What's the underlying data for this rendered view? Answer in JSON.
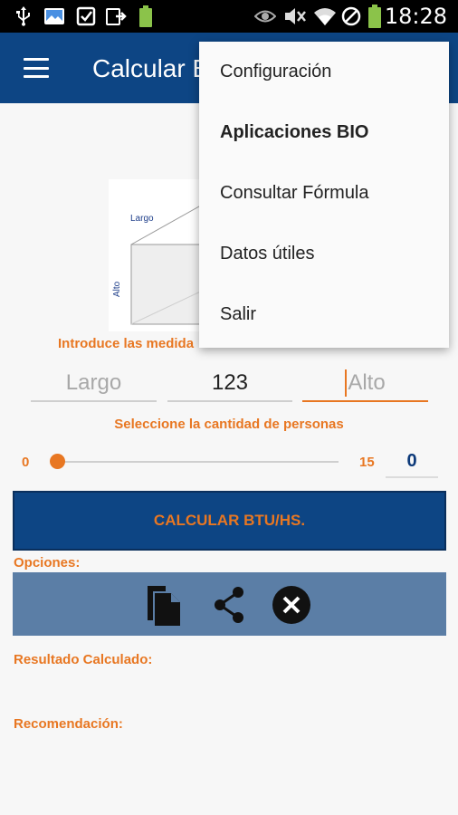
{
  "status_bar": {
    "time": "18:28",
    "icons": [
      "usb-icon",
      "image-icon",
      "checkbox-icon",
      "download-icon",
      "battery-small-icon",
      "eye-icon",
      "mute-icon",
      "wifi-icon",
      "no-sim-icon",
      "battery-icon"
    ]
  },
  "app_bar": {
    "title": "Calcular B",
    "menu_icon": "hamburger-icon"
  },
  "diagram": {
    "label_length": "Largo",
    "label_height": "Alto"
  },
  "form": {
    "instructions": "Introduce las medida",
    "largo_placeholder": "Largo",
    "ancho_value": "123",
    "alto_placeholder": "Alto",
    "persons_label": "Seleccione la cantidad de personas",
    "slider_min": "0",
    "slider_max": "15",
    "slider_value": "0"
  },
  "calculate_button": "CALCULAR BTU/HS.",
  "options": {
    "label": "Opciones:",
    "icons": [
      "copy-icon",
      "share-icon",
      "close-icon"
    ]
  },
  "result_label": "Resultado Calculado:",
  "recommendation_label": "Recomendación:",
  "overflow_menu": {
    "items": [
      "Configuración",
      "Aplicaciones BIO",
      "Consultar Fórmula",
      "Datos útiles",
      "Salir"
    ]
  },
  "colors": {
    "primary": "#0d4584",
    "accent": "#e87722",
    "options_bar": "#5b7ea6"
  }
}
